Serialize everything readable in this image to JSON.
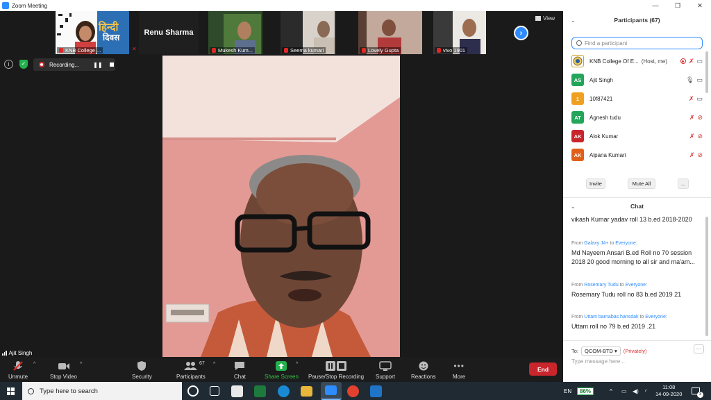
{
  "window": {
    "title": "Zoom Meeting"
  },
  "thumbnails": [
    {
      "name": "KNB College ...",
      "muted": true
    },
    {
      "name": "Renu Sharma",
      "muted": true,
      "name_only": true
    },
    {
      "name": "Mukesh Kum...",
      "muted": true
    },
    {
      "name": "Seema kumari",
      "muted": true
    },
    {
      "name": "Lovely Gupta",
      "muted": true
    },
    {
      "name": "vivo 1901",
      "muted": true
    }
  ],
  "thumb_banner": {
    "line1": "हिन्दी",
    "line2": "दिवस"
  },
  "view_label": "View",
  "recording": {
    "label": "Recording..."
  },
  "active_speaker": {
    "name": "Ajit Singh"
  },
  "toolbar": {
    "unmute": "Unmute",
    "stop_video": "Stop Video",
    "security": "Security",
    "participants": "Participants",
    "participants_count": "67",
    "chat": "Chat",
    "share_screen": "Share Screen",
    "pause_stop_recording": "Pause/Stop Recording",
    "support": "Support",
    "reactions": "Reactions",
    "more": "More",
    "end": "End"
  },
  "participants_panel": {
    "title": "Participants (67)",
    "search_placeholder": "Find a participant",
    "rows": [
      {
        "initials": "",
        "name": "KNB College Of E...",
        "role": "(Host, me)",
        "color": "#c9a227",
        "mic": "muted",
        "cam": "on",
        "recording": true
      },
      {
        "initials": "AS",
        "name": "Ajit Singh",
        "role": "",
        "color": "#23a55a",
        "mic": "on",
        "cam": "on",
        "recording": false
      },
      {
        "initials": "1",
        "name": "10f87421",
        "role": "",
        "color": "#f0a020",
        "mic": "muted",
        "cam": "on",
        "recording": false
      },
      {
        "initials": "AT",
        "name": "Agnesh tudu",
        "role": "",
        "color": "#23a55a",
        "mic": "muted",
        "cam": "off",
        "recording": false
      },
      {
        "initials": "AK",
        "name": "Alok Kumar",
        "role": "",
        "color": "#c8262c",
        "mic": "muted",
        "cam": "off",
        "recording": false
      },
      {
        "initials": "AK",
        "name": "Alpana Kumari",
        "role": "",
        "color": "#e0601a",
        "mic": "muted",
        "cam": "off",
        "recording": false
      }
    ],
    "invite": "Invite",
    "mute_all": "Mute All",
    "more": "..."
  },
  "chat": {
    "title": "Chat",
    "messages": [
      {
        "from": "",
        "to": "",
        "text": "vikash Kumar yadav roll 13 b.ed 2018-2020"
      },
      {
        "from": "Galaxy J4+",
        "to": "Everyone",
        "text": "Md Nayeem Ansari B.ed Roll no 70 session 2018 20 good morning to all sir and ma'am..."
      },
      {
        "from": "Rosemary Tudu",
        "to": "Everyone",
        "text": "Rosemary Tudu roll no 83 b.ed 2019 21"
      },
      {
        "from": "Uttam barnabas hansdak",
        "to": "Everyone",
        "text": "Uttam roll no 79 b.ed 2019 .21"
      }
    ],
    "from_word": "From",
    "to_word": "to",
    "to_label": "To:",
    "to_target": "QCOM-BTD",
    "privately": "(Privately)",
    "input_placeholder": "Type message here..."
  },
  "taskbar": {
    "search_placeholder": "Type here to search",
    "language": "EN",
    "battery": "86%",
    "time": "11:08",
    "date": "14-09-2020",
    "notifications": "3"
  }
}
